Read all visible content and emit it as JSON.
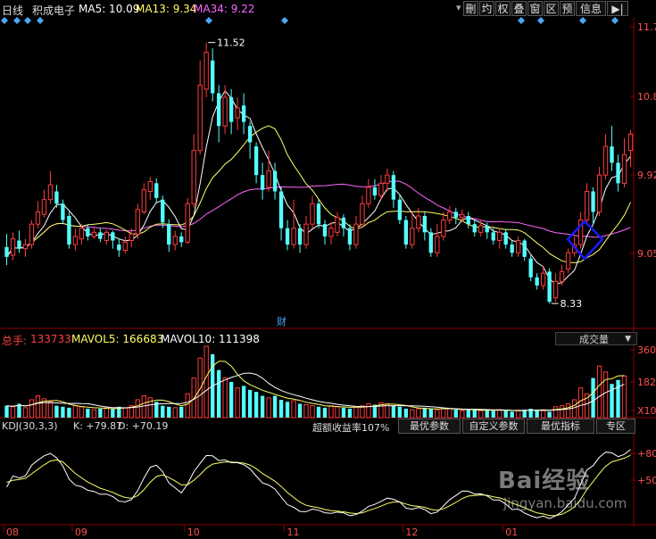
{
  "header": {
    "period": "日线",
    "stock_name": "积成电子",
    "ma5_label": "MA5: 10.09",
    "ma13_label": "MA13: 9.34",
    "ma34_label": "MA34: 9.22",
    "buttons": [
      "刪",
      "圴",
      "权",
      "叠",
      "窗",
      "区",
      "预",
      "信息",
      "▶|"
    ],
    "menu_arrow": "▾"
  },
  "price_axis": {
    "ticks": [
      "11.7",
      "10.8",
      "9.92",
      "9.05"
    ]
  },
  "annotations": {
    "high": "11.52",
    "low": "8.33",
    "finance_marker": "财"
  },
  "volume_panel": {
    "label_prefix": "总手:",
    "total": "133733",
    "mavol5": "MAVOL5: 166683",
    "mavol10": "MAVOL10: 111398",
    "selector": "成交量",
    "ticks": [
      "360",
      "182",
      "X10"
    ]
  },
  "kdj_panel": {
    "title": "KDJ(30,3,3)",
    "k": "K: +79.87",
    "d": "D: +70.19",
    "excess_return": "超额收益率107%",
    "buttons": [
      "最优参数",
      "自定义参数",
      "最优指标",
      "专区"
    ],
    "ticks": [
      "+80",
      "+50"
    ]
  },
  "date_axis": {
    "labels": [
      "08",
      "09",
      "10",
      "11",
      "12",
      "01"
    ]
  },
  "watermark": {
    "brand": "Bai经验",
    "url": "jingyan.baidu.com"
  },
  "colors": {
    "up": "#ff3c3c",
    "down": "#54ffff",
    "ma5": "#ffffff",
    "ma13": "#ffff66",
    "ma34": "#ff66ff",
    "highlight": "#1a1aff"
  },
  "chart_data": {
    "type": "candlestick",
    "price_range": [
      8.2,
      11.8
    ],
    "x_labels": [
      "08",
      "09",
      "10",
      "11",
      "12",
      "01"
    ],
    "label_index": [
      0,
      11,
      29,
      45,
      64,
      80
    ],
    "candles": [
      {
        "o": 9.02,
        "c": 8.9,
        "h": 9.18,
        "l": 8.8
      },
      {
        "o": 8.92,
        "c": 9.12,
        "h": 9.2,
        "l": 8.86
      },
      {
        "o": 9.1,
        "c": 9.0,
        "h": 9.22,
        "l": 8.95
      },
      {
        "o": 9.0,
        "c": 9.05,
        "h": 9.12,
        "l": 8.9
      },
      {
        "o": 9.05,
        "c": 9.3,
        "h": 9.35,
        "l": 9.0
      },
      {
        "o": 9.3,
        "c": 9.45,
        "h": 9.58,
        "l": 9.25
      },
      {
        "o": 9.42,
        "c": 9.6,
        "h": 9.72,
        "l": 9.38
      },
      {
        "o": 9.6,
        "c": 9.78,
        "h": 9.95,
        "l": 9.55
      },
      {
        "o": 9.7,
        "c": 9.55,
        "h": 9.78,
        "l": 9.5
      },
      {
        "o": 9.55,
        "c": 9.35,
        "h": 9.6,
        "l": 9.3
      },
      {
        "o": 9.4,
        "c": 9.05,
        "h": 9.45,
        "l": 9.0
      },
      {
        "o": 9.05,
        "c": 9.15,
        "h": 9.25,
        "l": 8.98
      },
      {
        "o": 9.12,
        "c": 9.25,
        "h": 9.3,
        "l": 9.05
      },
      {
        "o": 9.25,
        "c": 9.15,
        "h": 9.3,
        "l": 9.1
      },
      {
        "o": 9.15,
        "c": 9.2,
        "h": 9.26,
        "l": 9.12
      },
      {
        "o": 9.2,
        "c": 9.12,
        "h": 9.25,
        "l": 9.08
      },
      {
        "o": 9.1,
        "c": 9.2,
        "h": 9.23,
        "l": 9.05
      },
      {
        "o": 9.2,
        "c": 9.1,
        "h": 9.22,
        "l": 9.0
      },
      {
        "o": 9.05,
        "c": 8.98,
        "h": 9.12,
        "l": 8.9
      },
      {
        "o": 8.98,
        "c": 9.08,
        "h": 9.15,
        "l": 8.94
      },
      {
        "o": 9.1,
        "c": 9.18,
        "h": 9.25,
        "l": 9.02
      },
      {
        "o": 9.18,
        "c": 9.48,
        "h": 9.55,
        "l": 9.12
      },
      {
        "o": 9.45,
        "c": 9.72,
        "h": 9.8,
        "l": 9.42
      },
      {
        "o": 9.7,
        "c": 9.82,
        "h": 9.88,
        "l": 9.6
      },
      {
        "o": 9.8,
        "c": 9.62,
        "h": 9.86,
        "l": 9.55
      },
      {
        "o": 9.6,
        "c": 9.32,
        "h": 9.65,
        "l": 9.25
      },
      {
        "o": 9.3,
        "c": 9.05,
        "h": 9.36,
        "l": 8.96
      },
      {
        "o": 9.05,
        "c": 9.15,
        "h": 9.22,
        "l": 8.98
      },
      {
        "o": 9.15,
        "c": 9.08,
        "h": 9.2,
        "l": 9.02
      },
      {
        "o": 9.08,
        "c": 9.55,
        "h": 9.62,
        "l": 9.06
      },
      {
        "o": 9.55,
        "c": 10.2,
        "h": 10.4,
        "l": 9.5
      },
      {
        "o": 10.2,
        "c": 11.0,
        "h": 11.3,
        "l": 10.15
      },
      {
        "o": 10.95,
        "c": 11.4,
        "h": 11.52,
        "l": 10.85
      },
      {
        "o": 11.3,
        "c": 10.9,
        "h": 11.45,
        "l": 10.8
      },
      {
        "o": 10.9,
        "c": 10.5,
        "h": 11.0,
        "l": 10.3
      },
      {
        "o": 10.5,
        "c": 10.85,
        "h": 11.0,
        "l": 10.4
      },
      {
        "o": 10.85,
        "c": 10.55,
        "h": 10.95,
        "l": 10.4
      },
      {
        "o": 10.6,
        "c": 10.72,
        "h": 10.85,
        "l": 10.45
      },
      {
        "o": 10.75,
        "c": 10.55,
        "h": 10.9,
        "l": 10.4
      },
      {
        "o": 10.5,
        "c": 10.3,
        "h": 10.55,
        "l": 10.1
      },
      {
        "o": 10.25,
        "c": 9.9,
        "h": 10.3,
        "l": 9.8
      },
      {
        "o": 9.9,
        "c": 9.72,
        "h": 10.05,
        "l": 9.6
      },
      {
        "o": 9.75,
        "c": 9.95,
        "h": 10.2,
        "l": 9.7
      },
      {
        "o": 9.95,
        "c": 9.7,
        "h": 10.05,
        "l": 9.6
      },
      {
        "o": 9.7,
        "c": 9.25,
        "h": 9.75,
        "l": 9.1
      },
      {
        "o": 9.25,
        "c": 9.05,
        "h": 9.35,
        "l": 8.98
      },
      {
        "o": 9.05,
        "c": 9.25,
        "h": 9.6,
        "l": 9.0
      },
      {
        "o": 9.25,
        "c": 9.05,
        "h": 9.3,
        "l": 8.95
      },
      {
        "o": 9.05,
        "c": 9.3,
        "h": 9.4,
        "l": 9.0
      },
      {
        "o": 9.3,
        "c": 9.55,
        "h": 9.65,
        "l": 9.25
      },
      {
        "o": 9.55,
        "c": 9.3,
        "h": 9.6,
        "l": 9.25
      },
      {
        "o": 9.3,
        "c": 9.15,
        "h": 9.35,
        "l": 9.05
      },
      {
        "o": 9.15,
        "c": 9.25,
        "h": 9.32,
        "l": 9.05
      },
      {
        "o": 9.2,
        "c": 9.38,
        "h": 9.45,
        "l": 9.15
      },
      {
        "o": 9.38,
        "c": 9.25,
        "h": 9.42,
        "l": 9.15
      },
      {
        "o": 9.25,
        "c": 9.05,
        "h": 9.3,
        "l": 8.98
      },
      {
        "o": 9.05,
        "c": 9.3,
        "h": 9.4,
        "l": 9.0
      },
      {
        "o": 9.3,
        "c": 9.55,
        "h": 9.65,
        "l": 9.25
      },
      {
        "o": 9.55,
        "c": 9.75,
        "h": 9.85,
        "l": 9.5
      },
      {
        "o": 9.75,
        "c": 9.65,
        "h": 9.85,
        "l": 9.6
      },
      {
        "o": 9.65,
        "c": 9.8,
        "h": 9.9,
        "l": 9.6
      },
      {
        "o": 9.8,
        "c": 9.9,
        "h": 9.98,
        "l": 9.7
      },
      {
        "o": 9.9,
        "c": 9.6,
        "h": 9.95,
        "l": 9.5
      },
      {
        "o": 9.6,
        "c": 9.35,
        "h": 9.65,
        "l": 9.3
      },
      {
        "o": 9.35,
        "c": 9.05,
        "h": 9.4,
        "l": 9.0
      },
      {
        "o": 9.05,
        "c": 9.25,
        "h": 9.45,
        "l": 9.0
      },
      {
        "o": 9.25,
        "c": 9.4,
        "h": 9.5,
        "l": 9.2
      },
      {
        "o": 9.4,
        "c": 9.2,
        "h": 9.45,
        "l": 9.1
      },
      {
        "o": 9.2,
        "c": 8.95,
        "h": 9.25,
        "l": 8.9
      },
      {
        "o": 8.95,
        "c": 9.15,
        "h": 9.3,
        "l": 8.9
      },
      {
        "o": 9.15,
        "c": 9.35,
        "h": 9.45,
        "l": 9.1
      },
      {
        "o": 9.35,
        "c": 9.45,
        "h": 9.52,
        "l": 9.3
      },
      {
        "o": 9.45,
        "c": 9.38,
        "h": 9.5,
        "l": 9.3
      },
      {
        "o": 9.38,
        "c": 9.42,
        "h": 9.48,
        "l": 9.32
      },
      {
        "o": 9.4,
        "c": 9.3,
        "h": 9.45,
        "l": 9.25
      },
      {
        "o": 9.3,
        "c": 9.2,
        "h": 9.35,
        "l": 9.15
      },
      {
        "o": 9.2,
        "c": 9.28,
        "h": 9.35,
        "l": 9.15
      },
      {
        "o": 9.28,
        "c": 9.2,
        "h": 9.32,
        "l": 9.12
      },
      {
        "o": 9.2,
        "c": 9.1,
        "h": 9.25,
        "l": 9.05
      },
      {
        "o": 9.1,
        "c": 9.2,
        "h": 9.25,
        "l": 9.0
      },
      {
        "o": 9.2,
        "c": 9.05,
        "h": 9.24,
        "l": 9.0
      },
      {
        "o": 9.05,
        "c": 8.95,
        "h": 9.1,
        "l": 8.9
      },
      {
        "o": 8.95,
        "c": 9.1,
        "h": 9.15,
        "l": 8.9
      },
      {
        "o": 9.1,
        "c": 8.9,
        "h": 9.12,
        "l": 8.85
      },
      {
        "o": 8.88,
        "c": 8.65,
        "h": 8.92,
        "l": 8.6
      },
      {
        "o": 8.65,
        "c": 8.55,
        "h": 8.7,
        "l": 8.5
      },
      {
        "o": 8.55,
        "c": 8.7,
        "h": 8.78,
        "l": 8.5
      },
      {
        "o": 8.72,
        "c": 8.35,
        "h": 8.76,
        "l": 8.33
      },
      {
        "o": 8.4,
        "c": 8.6,
        "h": 8.7,
        "l": 8.35
      },
      {
        "o": 8.6,
        "c": 8.72,
        "h": 8.8,
        "l": 8.55
      },
      {
        "o": 8.75,
        "c": 8.95,
        "h": 9.0,
        "l": 8.7
      },
      {
        "o": 8.95,
        "c": 9.05,
        "h": 9.15,
        "l": 8.9
      },
      {
        "o": 9.05,
        "c": 9.35,
        "h": 9.45,
        "l": 9.0
      },
      {
        "o": 9.35,
        "c": 9.7,
        "h": 9.8,
        "l": 9.3
      },
      {
        "o": 9.7,
        "c": 9.45,
        "h": 9.75,
        "l": 9.3
      },
      {
        "o": 9.45,
        "c": 9.9,
        "h": 10.0,
        "l": 9.4
      },
      {
        "o": 9.9,
        "c": 10.25,
        "h": 10.4,
        "l": 9.85
      },
      {
        "o": 10.25,
        "c": 10.05,
        "h": 10.5,
        "l": 9.95
      },
      {
        "o": 10.05,
        "c": 9.8,
        "h": 10.15,
        "l": 9.7
      },
      {
        "o": 9.8,
        "c": 10.15,
        "h": 10.35,
        "l": 9.75
      },
      {
        "o": 10.2,
        "c": 10.4,
        "h": 10.45,
        "l": 10.0
      }
    ],
    "volume": [
      60,
      55,
      70,
      50,
      90,
      110,
      95,
      80,
      60,
      55,
      50,
      60,
      55,
      45,
      40,
      45,
      50,
      45,
      55,
      50,
      60,
      90,
      110,
      100,
      80,
      60,
      55,
      50,
      55,
      120,
      200,
      300,
      360,
      320,
      240,
      200,
      180,
      150,
      160,
      140,
      130,
      110,
      100,
      110,
      90,
      80,
      85,
      70,
      65,
      60,
      55,
      50,
      60,
      55,
      50,
      45,
      55,
      60,
      70,
      65,
      75,
      70,
      60,
      55,
      45,
      40,
      45,
      50,
      45,
      40,
      45,
      45,
      40,
      35,
      40,
      38,
      35,
      40,
      35,
      40,
      35,
      30,
      35,
      40,
      45,
      40,
      35,
      30,
      55,
      60,
      70,
      90,
      150,
      120,
      200,
      260,
      230,
      170,
      190,
      210
    ],
    "kdj_range": [
      0,
      100
    ]
  }
}
